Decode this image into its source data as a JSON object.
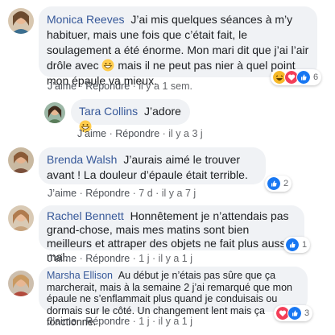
{
  "comments": [
    {
      "author": "Monica Reeves",
      "text_1": "J’ai mis quelques séances à m’y habituer, mais une fois que c’était fait, le soulagement a été énorme. Mon mari dit que j’ai l’air drôle avec",
      "text_2": "mais il ne peut pas nier à quel point mon épaule va mieux.",
      "like": "J’aime",
      "reply": "Répondre",
      "time": "il y a 1 sem.",
      "reaction_count": "6",
      "reaction_icons": [
        "haha-icon",
        "love-icon",
        "like-icon"
      ]
    },
    {
      "author": "Tara Collins",
      "text": "J’adore",
      "like": "J’aime",
      "reply": "Répondre",
      "time": "il y a 3 j"
    },
    {
      "author": "Brenda Walsh",
      "text": "J’aurais aimé le trouver avant ! La douleur d’épaule était terrible.",
      "like": "J’aime",
      "reply": "Répondre",
      "time": "7 d · il y a 7 j",
      "reaction_count": "2",
      "reaction_icons": [
        "like-icon"
      ]
    },
    {
      "author": "Rachel Bennett",
      "text": "Honnêtement je n’attendais pas grand-chose, mais mes matins sont bien meilleurs et attraper des objets ne fait plus aussi mal.",
      "like": "J’aime",
      "reply": "Répondre",
      "time": "1 j · il y a 1 j",
      "reaction_count": "1",
      "reaction_icons": [
        "like-icon"
      ]
    },
    {
      "author": "Marsha Ellison",
      "text": "Au début je n’étais pas sûre que ça marcherait, mais à la semaine 2 j’ai remarqué que mon épaule ne s’enflammait plus quand je conduisais ou dormais sur le côté. Un changement lent mais ça fonctionne.",
      "like": "J’aime",
      "reply": "Répondre",
      "time": "1 j · il y a 1 j",
      "reaction_count": "3",
      "reaction_icons": [
        "love-icon",
        "like-icon"
      ]
    }
  ],
  "separator": "·",
  "colors": {
    "bubble": "#f0f2f5",
    "author": "#365899",
    "meta": "#65676b",
    "like_blue": "#1877f2",
    "love_red": "#f33e58",
    "haha_yellow": "#f7b928"
  }
}
